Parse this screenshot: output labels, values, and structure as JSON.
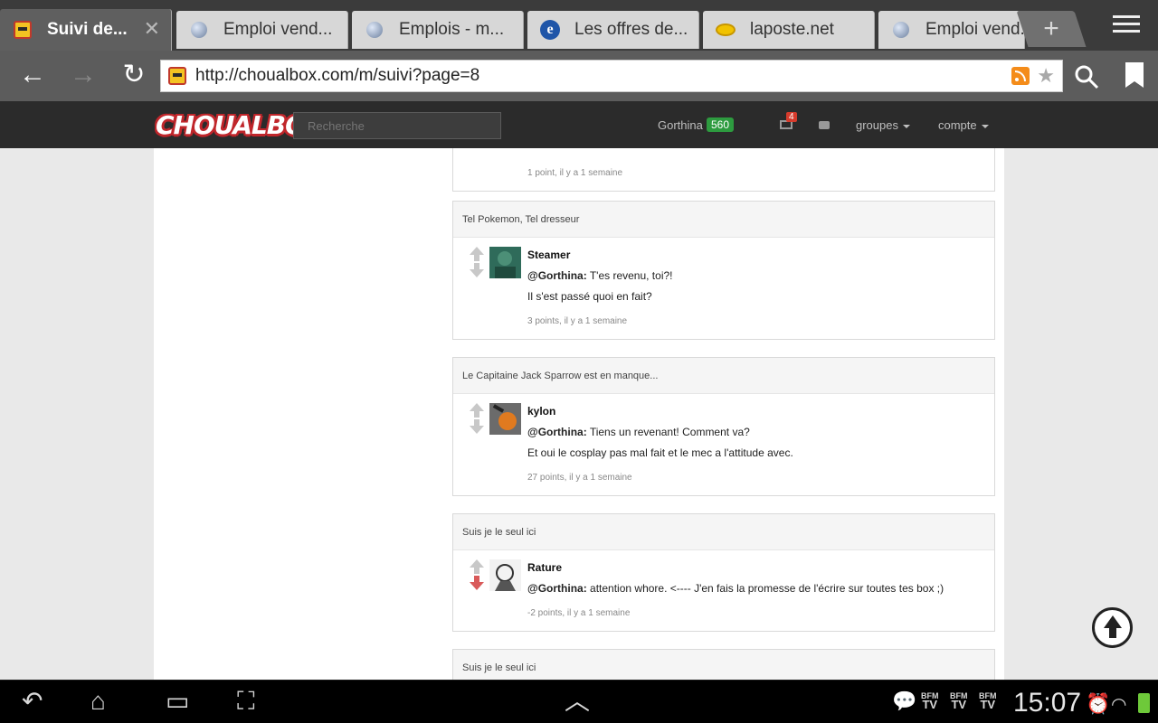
{
  "tabs": [
    {
      "title": "Suivi de...",
      "icon": "choualbox-favicon",
      "active": true
    },
    {
      "title": "Emploi vend...",
      "icon": "globe-icon"
    },
    {
      "title": "Emplois - m...",
      "icon": "globe-icon"
    },
    {
      "title": "Les offres de...",
      "icon": "ie-icon"
    },
    {
      "title": "laposte.net",
      "icon": "laposte-icon"
    },
    {
      "title": "Emploi vend...",
      "icon": "globe-icon"
    }
  ],
  "toolbar": {
    "url": "http://choualbox.com/m/suivi?page=8"
  },
  "site": {
    "logo": "CHOUALBOX",
    "search_placeholder": "Recherche",
    "user_name": "Gorthina",
    "user_score": "560",
    "mail_count": "4",
    "groups_label": "groupes",
    "account_label": "compte"
  },
  "cards": [
    {
      "title": "",
      "comment": {
        "author": "",
        "lines": [],
        "meta": "1 point, il y a 1 semaine",
        "vote": "neutral"
      }
    },
    {
      "title": "Tel Pokemon, Tel dresseur",
      "comment": {
        "author": "Steamer",
        "mention": "@Gorthina:",
        "line1": " T'es revenu, toi?!",
        "line2": "Il s'est passé quoi en fait?",
        "meta": "3 points, il y a 1 semaine",
        "vote": "neutral"
      }
    },
    {
      "title": "Le Capitaine Jack Sparrow est en manque...",
      "comment": {
        "author": "kylon",
        "mention": "@Gorthina:",
        "line1": " Tiens un revenant! Comment va?",
        "line2": "Et oui le cosplay pas mal fait et le mec a l'attitude avec.",
        "meta": "27 points, il y a 1 semaine",
        "vote": "neutral"
      }
    },
    {
      "title": "Suis je le seul ici",
      "comment": {
        "author": "Rature",
        "mention": "@Gorthina:",
        "line1": " attention whore. <---- J'en fais la promesse de l'écrire sur toutes tes box ;)",
        "meta": "-2 points, il y a 1 semaine",
        "vote": "down"
      }
    },
    {
      "title": "Suis je le seul ici"
    }
  ],
  "system": {
    "clock": "15:07",
    "bfm_top": "BFM",
    "bfm_bottom": "TV"
  },
  "colors": {
    "score_badge": "#2d9b3f",
    "mail_badge": "#d63b2c",
    "downvote": "#d95a5a",
    "logo_outline": "#c0262b"
  }
}
